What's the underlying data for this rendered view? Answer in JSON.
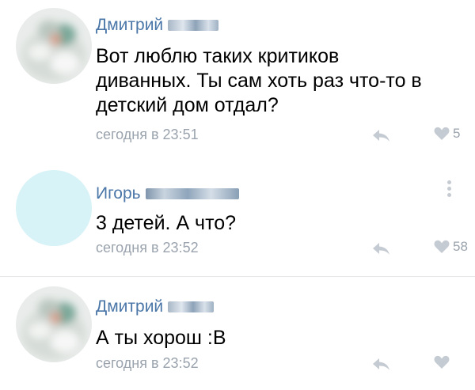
{
  "comments": [
    {
      "author": "Дмитрий",
      "text": "Вот люблю таких критиков\nдиванных. Ты сам хоть раз что-то в\nдетский дом отдал?",
      "time": "сегодня в 23:51",
      "likes": "5",
      "avatar_color": "#d8ddd6"
    },
    {
      "author": "Игорь",
      "text": "3 детей. А что?",
      "time": "сегодня в 23:52",
      "likes": "58",
      "avatar_color": "#d6f3f7"
    },
    {
      "author": "Дмитрий",
      "text": "А ты хорош :В",
      "time": "сегодня в 23:52",
      "likes": "",
      "avatar_color": "#d8ddd6"
    }
  ],
  "colors": {
    "author": "#4a76a8",
    "meta": "#9aa3ad",
    "icon": "#c5cbd2"
  },
  "icons": {
    "reply": "reply-arrow-icon",
    "like": "heart-icon",
    "more": "vertical-dots-icon"
  }
}
